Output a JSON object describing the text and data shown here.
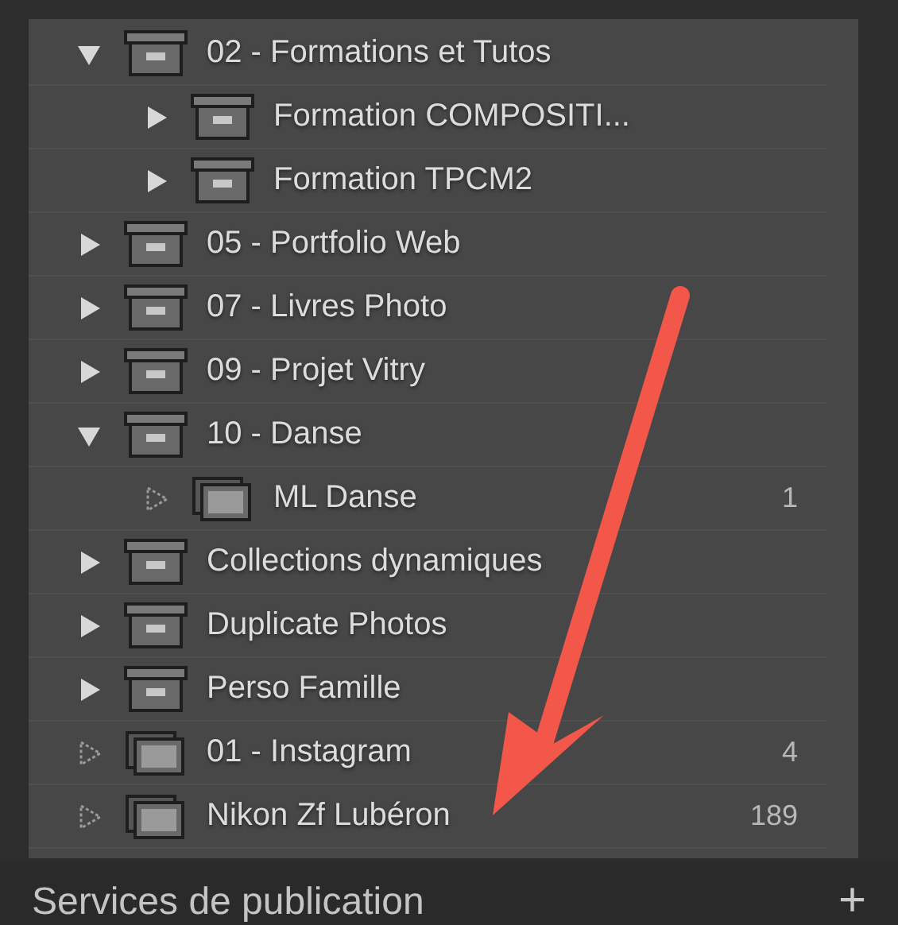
{
  "collections": [
    {
      "kind": "set",
      "label": "02 - Formations et Tutos",
      "expanded": true,
      "children": [
        {
          "kind": "set",
          "label": "Formation COMPOSITI...",
          "expanded": false
        },
        {
          "kind": "set",
          "label": "Formation TPCM2",
          "expanded": false
        }
      ]
    },
    {
      "kind": "set",
      "label": "05 - Portfolio Web",
      "expanded": false
    },
    {
      "kind": "set",
      "label": "07 - Livres Photo",
      "expanded": false
    },
    {
      "kind": "set",
      "label": "09 - Projet Vitry",
      "expanded": false
    },
    {
      "kind": "set",
      "label": "10 - Danse",
      "expanded": true,
      "children": [
        {
          "kind": "collection",
          "label": "ML Danse",
          "count": "1"
        }
      ]
    },
    {
      "kind": "set",
      "label": "Collections dynamiques",
      "expanded": false
    },
    {
      "kind": "set",
      "label": "Duplicate Photos",
      "expanded": false
    },
    {
      "kind": "set",
      "label": "Perso Famille",
      "expanded": false
    },
    {
      "kind": "collection",
      "label": "01 - Instagram",
      "count": "4"
    },
    {
      "kind": "collection",
      "label": "Nikon Zf Lubéron",
      "count": "189"
    }
  ],
  "publish_header": {
    "title": "Services de publication",
    "add_button": "+"
  }
}
